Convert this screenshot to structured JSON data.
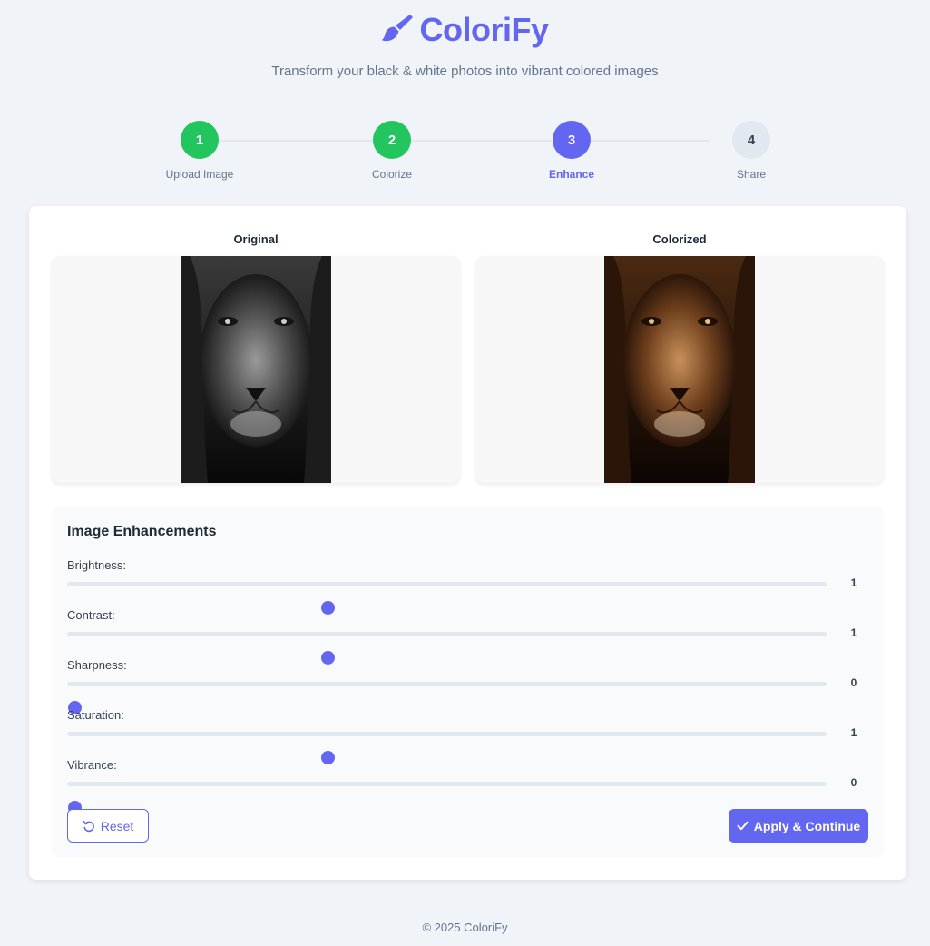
{
  "app": {
    "name": "ColoriFy",
    "tagline": "Transform your black & white photos into vibrant colored images",
    "logo_icon": "paintbrush-icon",
    "accent_color": "#6366f1",
    "success_color": "#22c55e"
  },
  "steps": [
    {
      "number": "1",
      "label": "Upload Image",
      "state": "done"
    },
    {
      "number": "2",
      "label": "Colorize",
      "state": "done"
    },
    {
      "number": "3",
      "label": "Enhance",
      "state": "active"
    },
    {
      "number": "4",
      "label": "Share",
      "state": "pending"
    }
  ],
  "preview": {
    "original_title": "Original",
    "colorized_title": "Colorized"
  },
  "enhancements": {
    "title": "Image Enhancements",
    "sliders": [
      {
        "label": "Brightness:",
        "value": "1",
        "fraction": 0.34
      },
      {
        "label": "Contrast:",
        "value": "1",
        "fraction": 0.34
      },
      {
        "label": "Sharpness:",
        "value": "0",
        "fraction": 0.0
      },
      {
        "label": "Saturation:",
        "value": "1",
        "fraction": 0.34
      },
      {
        "label": "Vibrance:",
        "value": "0",
        "fraction": 0.0
      }
    ],
    "reset_label": "Reset",
    "reset_icon": "undo-icon",
    "apply_label": "Apply & Continue",
    "apply_icon": "check-icon"
  },
  "footer": {
    "text": "© 2025 ColoriFy"
  }
}
